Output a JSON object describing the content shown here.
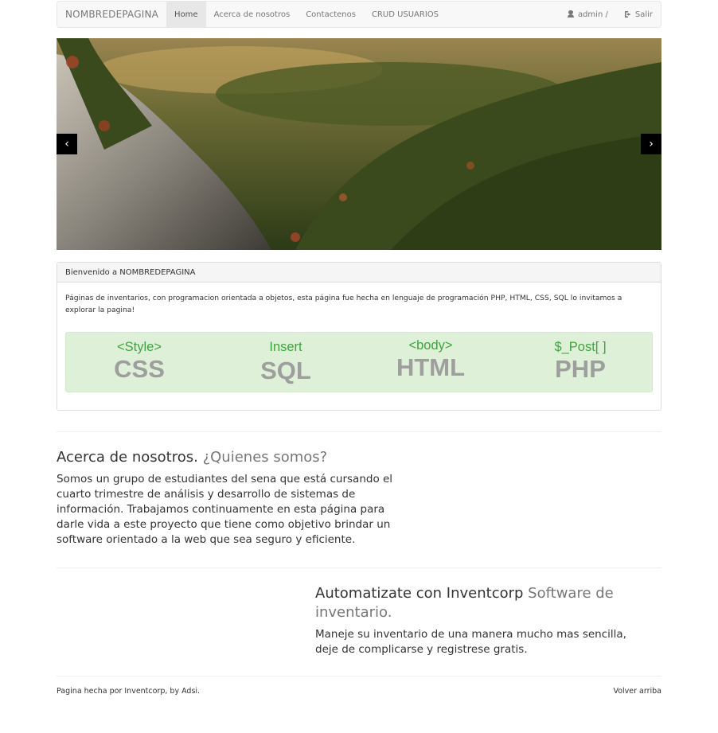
{
  "navbar": {
    "brand": "NOMBREDEPAGINA",
    "links": [
      "Home",
      "Acerca de nosotros",
      "Contactenos",
      "CRUD USUARIOS"
    ],
    "active": "Home",
    "user_label": "admin /",
    "logout_label": "Salir"
  },
  "carousel": {
    "prev_glyph": "‹",
    "next_glyph": "›"
  },
  "panel": {
    "heading": "Bienvenido a NOMBREDEPAGINA",
    "text": "Páginas de inventarios, con programacion orientada a objetos, esta página fue hecha en lenguaje de programación PHP, HTML, CSS, SQL lo invitamos a explorar la pagina!",
    "tech": [
      {
        "tag": "<Style>",
        "name": "CSS"
      },
      {
        "tag": "Insert",
        "name": "SQL"
      },
      {
        "tag": "<body>",
        "name": "HTML"
      },
      {
        "tag": "$_Post[ ]",
        "name": "PHP"
      }
    ]
  },
  "about": {
    "title": "Acerca de nosotros.",
    "subtitle": "¿Quienes somos?",
    "text": "Somos un grupo de estudiantes del sena que está cursando el cuarto trimestre de análisis y desarrollo de sistemas de información. Trabajamos continuamente en esta página para darle vida a este proyecto que tiene como objetivo brindar un software orientado a la web que sea seguro y eficiente."
  },
  "automate": {
    "title": "Automatizate con Inventcorp",
    "subtitle": "Software de inventario.",
    "text": "Maneje su inventario de una manera mucho mas sencilla, deje de complicarse y registrese gratis."
  },
  "footer": {
    "credit": "Pagina hecha por Inventcorp, by Adsi.",
    "back_top": "Volver arriba"
  },
  "colors": {
    "tech_box_bg": "#dff0d8",
    "tech_tag": "#3fa33f",
    "tech_name": "#9e9e9e"
  }
}
